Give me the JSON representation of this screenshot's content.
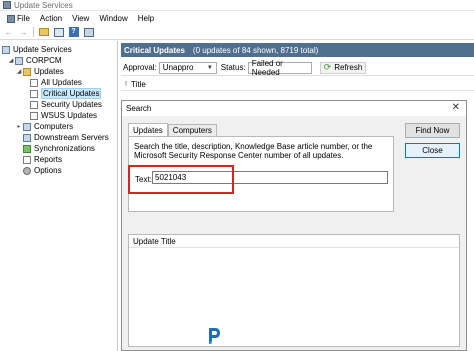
{
  "window": {
    "title": "Update Services"
  },
  "menu": [
    "File",
    "Action",
    "View",
    "Window",
    "Help"
  ],
  "tree": {
    "root": "Update Services",
    "server": "CORPCM",
    "updates": "Updates",
    "all_updates": "All Updates",
    "critical_updates": "Critical Updates",
    "security_updates": "Security Updates",
    "wsus_updates": "WSUS Updates",
    "computers": "Computers",
    "downstream": "Downstream Servers",
    "synchronizations": "Synchronizations",
    "reports": "Reports",
    "options": "Options"
  },
  "panel": {
    "title": "Critical Updates",
    "summary": "(0 updates of 84 shown, 8719 total)"
  },
  "filter": {
    "approval_label": "Approval:",
    "approval_value": "Unappro",
    "status_label": "Status:",
    "status_value": "Failed or Needed",
    "refresh_label": "Refresh"
  },
  "columns": {
    "title": "Title"
  },
  "dialog": {
    "title": "Search",
    "tabs": [
      "Updates",
      "Computers"
    ],
    "description": "Search the title, description, Knowledge Base article number, or the Microsoft Security Response Center number of all updates.",
    "text_label": "Text:",
    "text_value": "5021043",
    "find_now": "Find Now",
    "close": "Close",
    "results_header": "Update Title"
  },
  "colors": {
    "header_bg": "#4f6f8f",
    "highlight": "#d92323",
    "selection": "#cce8ff"
  }
}
